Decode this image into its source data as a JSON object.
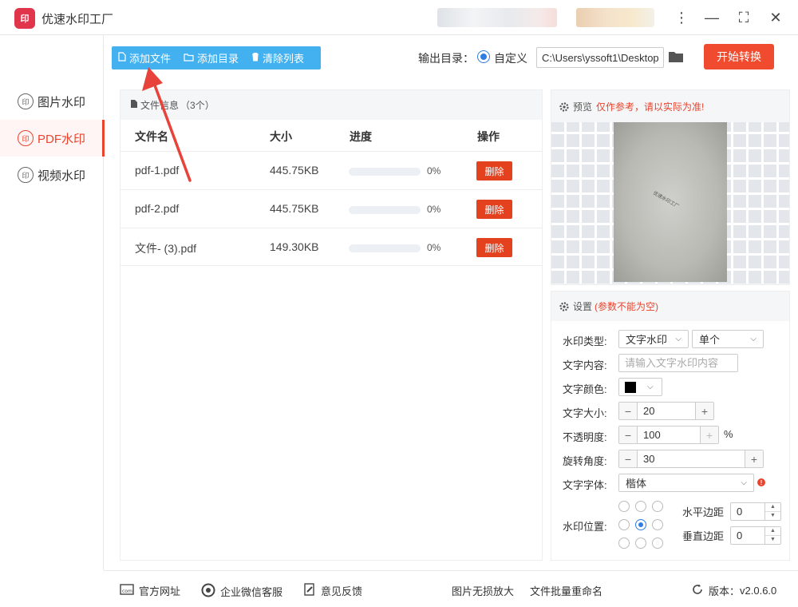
{
  "window": {
    "title": "优速水印工厂",
    "logo_text": "印",
    "minimize": "—",
    "maximize": "⛶",
    "close": "✕",
    "menu": "⋮"
  },
  "sidebar": {
    "items": [
      {
        "label": "图片水印",
        "icon": "印"
      },
      {
        "label": "PDF水印",
        "icon": "印"
      },
      {
        "label": "视频水印",
        "icon": "印"
      }
    ]
  },
  "toolbar": {
    "add_file": "添加文件",
    "add_dir": "添加目录",
    "clear_list": "清除列表"
  },
  "output": {
    "label": "输出目录：",
    "option": "自定义",
    "path": "C:\\Users\\yssoft1\\Desktop"
  },
  "start_button": "开始转换",
  "file_panel": {
    "title": "文件信息",
    "count": "（3个）",
    "columns": {
      "name": "文件名",
      "size": "大小",
      "progress": "进度",
      "action": "操作"
    },
    "rows": [
      {
        "name": "pdf-1.pdf",
        "size": "445.75KB",
        "progress": 0,
        "pct": "0%",
        "delete": "删除"
      },
      {
        "name": "pdf-2.pdf",
        "size": "445.75KB",
        "progress": 0,
        "pct": "0%",
        "delete": "删除"
      },
      {
        "name": "文件- (3).pdf",
        "size": "149.30KB",
        "progress": 0,
        "pct": "0%",
        "delete": "删除"
      }
    ]
  },
  "preview": {
    "title": "预览",
    "note": "仅作参考，请以实际为准!",
    "watermark_text": "优速水印工厂"
  },
  "settings": {
    "title": "设置",
    "note": "(参数不能为空)",
    "wm_type_label": "水印类型:",
    "wm_type": "文字水印",
    "wm_mode": "单个",
    "text_label": "文字内容:",
    "text_placeholder": "请输入文字水印内容",
    "color_label": "文字颜色:",
    "color": "#000000",
    "size_label": "文字大小:",
    "size": "20",
    "opacity_label": "不透明度:",
    "opacity": "100",
    "opacity_unit": "%",
    "rotate_label": "旋转角度:",
    "rotate": "30",
    "font_label": "文字字体:",
    "font": "楷体",
    "position_label": "水印位置:",
    "h_margin_label": "水平边距",
    "h_margin": "0",
    "v_margin_label": "垂直边距",
    "v_margin": "0",
    "minus": "−",
    "plus": "+",
    "warn": "!"
  },
  "footer": {
    "website": "官方网址",
    "wechat": "企业微信客服",
    "feedback": "意见反馈",
    "enlarge": "图片无损放大",
    "rename": "文件批量重命名",
    "version_label": "版本：",
    "version": "v2.0.6.0"
  },
  "colors": {
    "accent_blue": "#43b1f0",
    "start_red": "#f04b2f",
    "active_red": "#e8442e",
    "delete_red": "#e4411f"
  }
}
